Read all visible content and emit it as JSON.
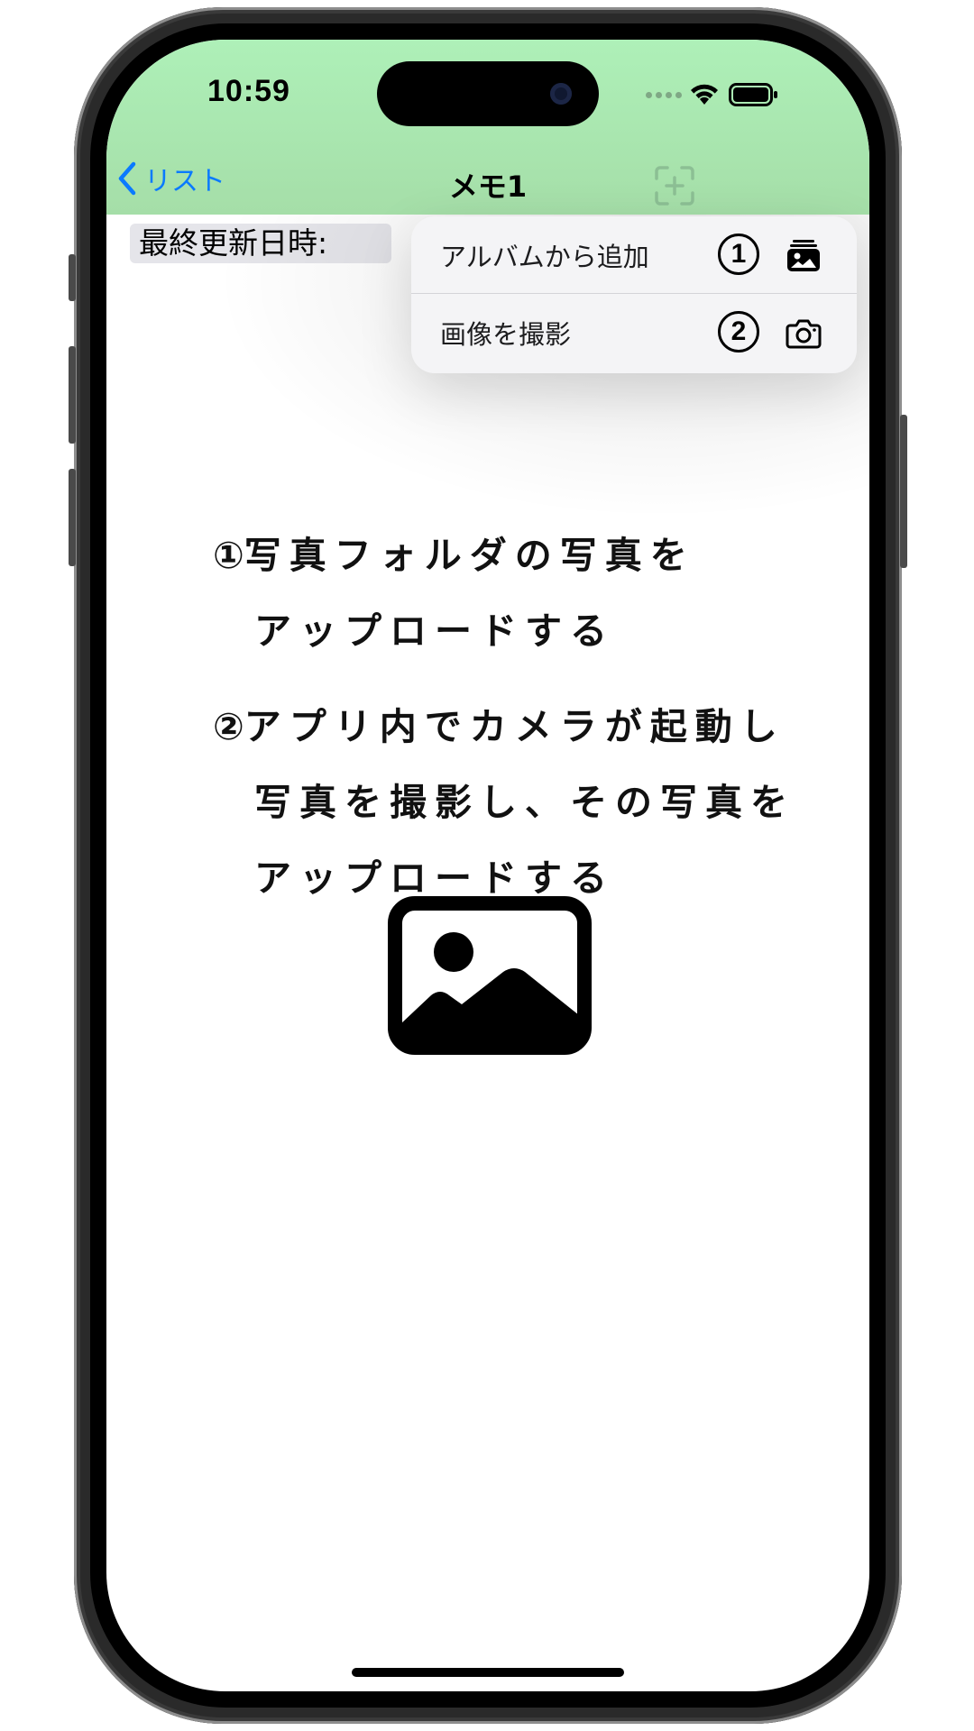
{
  "status_bar": {
    "time": "10:59"
  },
  "nav": {
    "back_label": "リスト",
    "title": "メモ1"
  },
  "content": {
    "updated_label": "最終更新日時:"
  },
  "menu": {
    "items": [
      {
        "label": "アルバムから追加",
        "number": "1",
        "icon": "photo-stack-icon"
      },
      {
        "label": "画像を撮影",
        "number": "2",
        "icon": "camera-icon"
      }
    ]
  },
  "note": {
    "line1_mark": "①",
    "line1_a": "写真フォルダの写真を",
    "line1_b": "アップロードする",
    "line2_mark": "②",
    "line2_a": "アプリ内でカメラが起動し",
    "line2_b": "写真を撮影し、その写真を",
    "line2_c": "アップロードする"
  },
  "colors": {
    "header_bg": "#aef0b8",
    "accent_blue": "#0a7aff",
    "menu_bg": "#f4f4f6"
  }
}
